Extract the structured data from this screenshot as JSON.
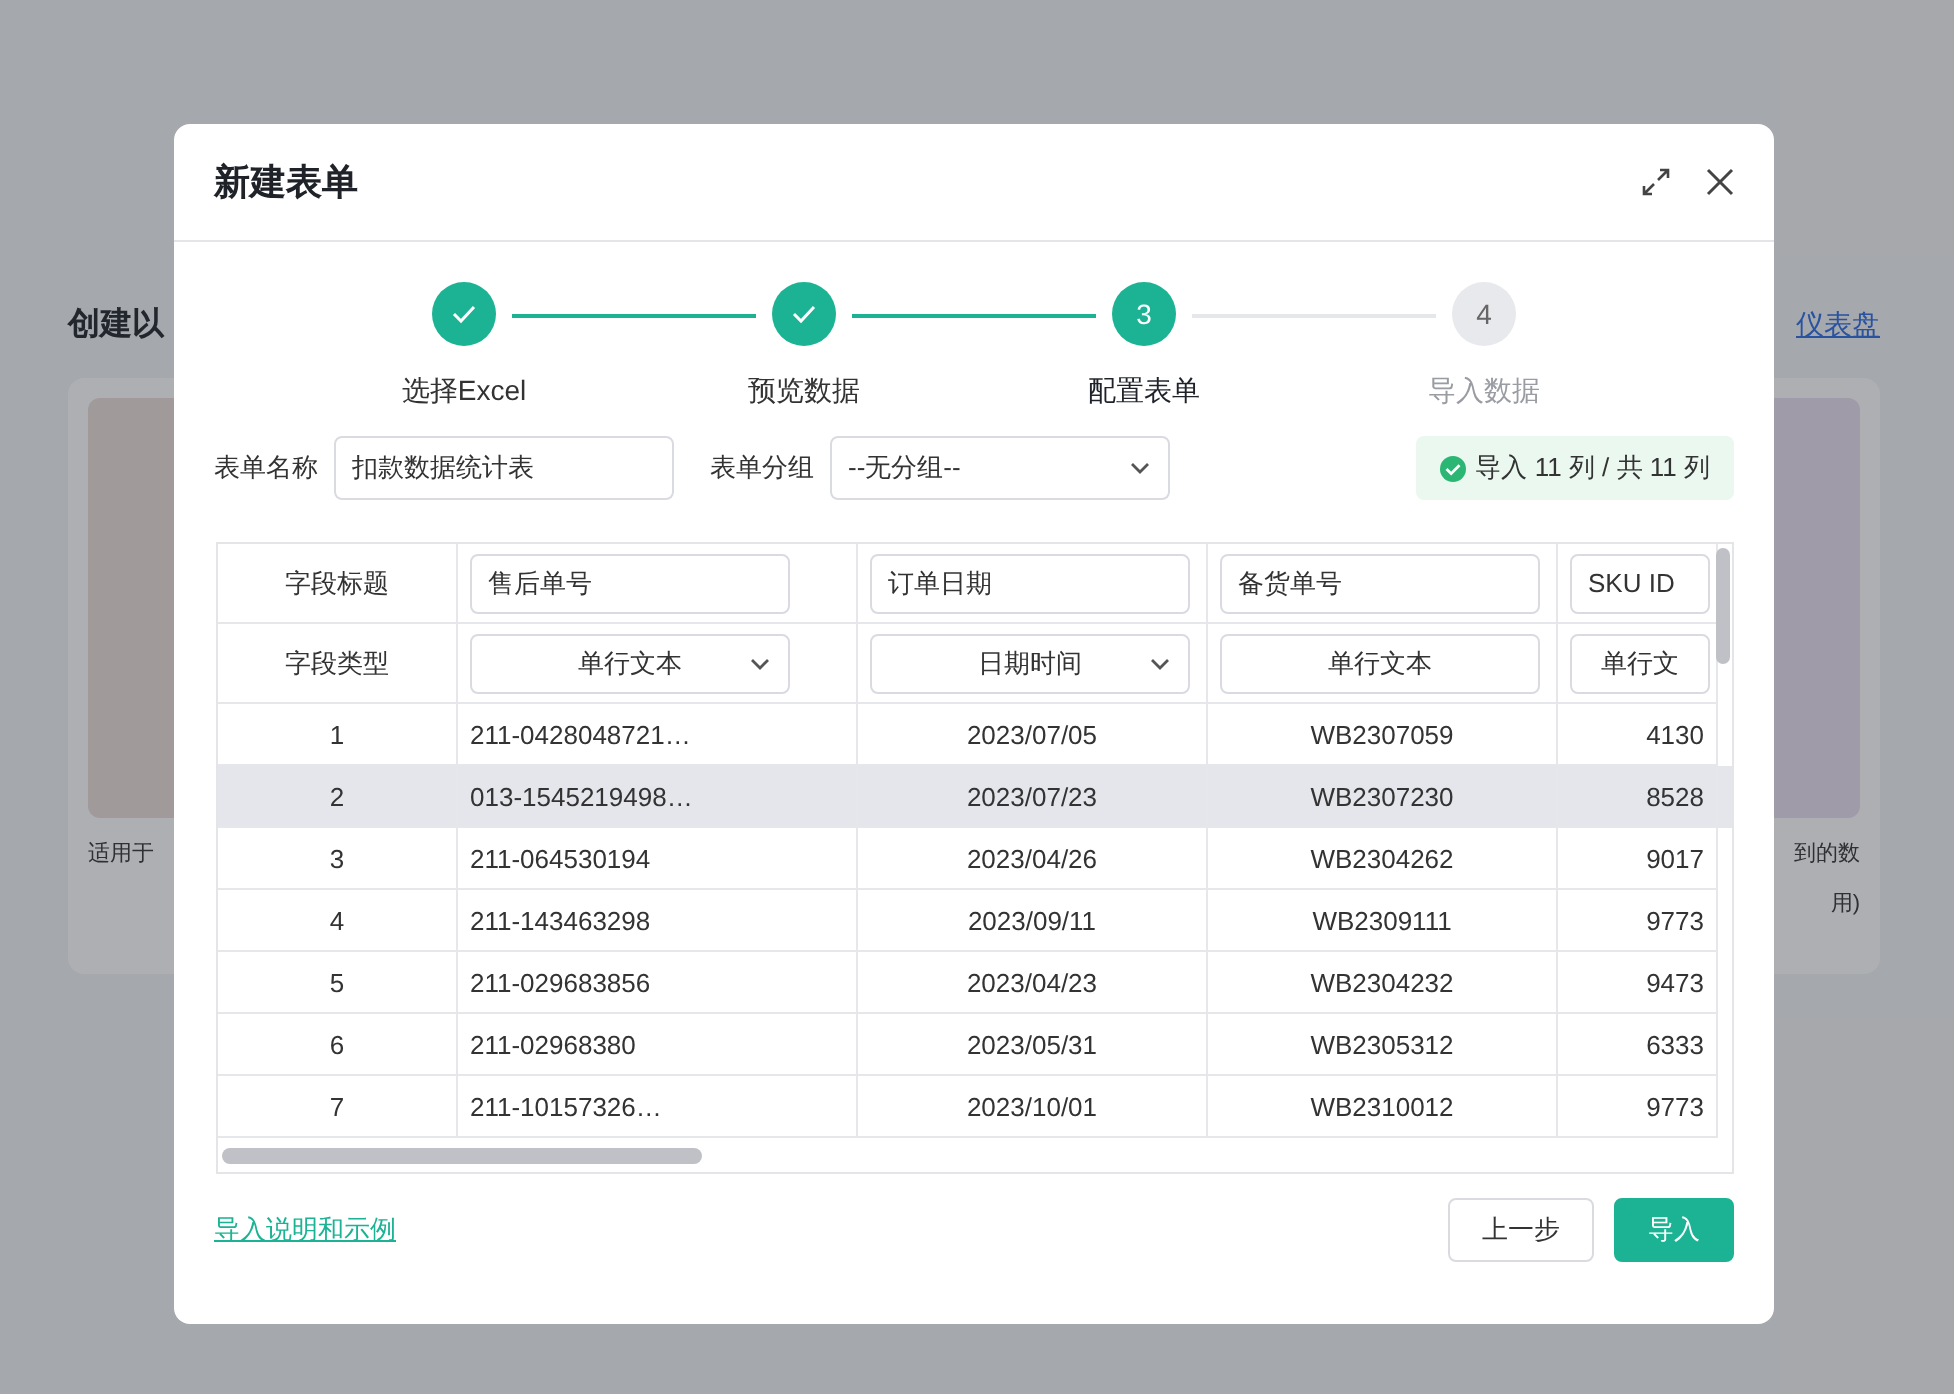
{
  "background": {
    "heading": "创建以",
    "link": "仪表盘",
    "cards": [
      {
        "text": "适用于"
      },
      {
        "text": "到的数",
        "text_2": "用)"
      }
    ]
  },
  "dialog": {
    "title": "新建表单",
    "steps": [
      {
        "label": "选择Excel",
        "completed": true,
        "active": false
      },
      {
        "label": "预览数据",
        "completed": true,
        "active": false
      },
      {
        "label": "配置表单",
        "number": "3",
        "completed": false,
        "active": true
      },
      {
        "label": "导入数据",
        "number": "4",
        "completed": false,
        "active": false
      }
    ],
    "form_name": {
      "label": "表单名称",
      "value": "扣款数据统计表"
    },
    "form_group": {
      "label": "表单分组",
      "value": "--无分组--"
    },
    "import_status": "导入 11 列 / 共 11 列",
    "table": {
      "title_label": "字段标题",
      "type_label": "字段类型",
      "columns": [
        {
          "title": "售后单号",
          "type": "单行文本",
          "has_caret": true
        },
        {
          "title": "订单日期",
          "type": "日期时间",
          "has_caret": true
        },
        {
          "title": "备货单号",
          "type": "单行文本",
          "has_caret": false
        },
        {
          "title": "SKU ID",
          "type": "单行文",
          "has_caret": false
        }
      ],
      "rows": [
        {
          "index": "1",
          "cells": [
            "211-0428048721…",
            "2023/07/05",
            "WB2307059",
            "4130"
          ],
          "selected": false
        },
        {
          "index": "2",
          "cells": [
            "013-1545219498…",
            "2023/07/23",
            "WB2307230",
            "8528"
          ],
          "selected": true
        },
        {
          "index": "3",
          "cells": [
            "211-064530194",
            "2023/04/26",
            "WB2304262",
            "9017"
          ],
          "selected": false
        },
        {
          "index": "4",
          "cells": [
            "211-143463298",
            "2023/09/11",
            "WB2309111",
            "9773"
          ],
          "selected": false
        },
        {
          "index": "5",
          "cells": [
            "211-029683856",
            "2023/04/23",
            "WB2304232",
            "9473"
          ],
          "selected": false
        },
        {
          "index": "6",
          "cells": [
            "211-02968380",
            "2023/05/31",
            "WB2305312",
            "6333"
          ],
          "selected": false
        },
        {
          "index": "7",
          "cells": [
            "211-10157326…",
            "2023/10/01",
            "WB2310012",
            "9773"
          ],
          "selected": false
        }
      ]
    },
    "help_link": "导入说明和示例",
    "buttons": [
      {
        "label": "上一步",
        "kind": "secondary"
      },
      {
        "label": "导入",
        "kind": "primary"
      }
    ]
  }
}
